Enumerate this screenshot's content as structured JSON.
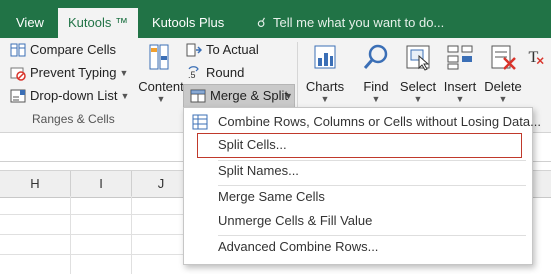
{
  "tabs": {
    "view": "View",
    "kutools": "Kutools ™",
    "kutools_plus": "Kutools Plus",
    "tell_me": "Tell me what you want to do..."
  },
  "ribbon": {
    "compare_cells": "Compare Cells",
    "prevent_typing": "Prevent Typing",
    "dropdown_list": "Drop-down List",
    "content": "Content",
    "to_actual": "To Actual",
    "round": "Round",
    "merge_split": "Merge & Split",
    "charts": "Charts",
    "find": "Find",
    "select": "Select",
    "insert": "Insert",
    "delete": "Delete",
    "group_ranges_cells": "Ranges & Cells"
  },
  "columns": [
    "H",
    "I",
    "J"
  ],
  "menu": {
    "combine": "Combine Rows, Columns or Cells without Losing Data...",
    "split_cells": "Split Cells...",
    "split_names": "Split Names...",
    "merge_same": "Merge Same Cells",
    "unmerge_fill": "Unmerge Cells & Fill Value",
    "advanced_combine": "Advanced Combine Rows..."
  },
  "colors": {
    "ribbon_green": "#217346",
    "highlight_border": "#c0392b"
  }
}
